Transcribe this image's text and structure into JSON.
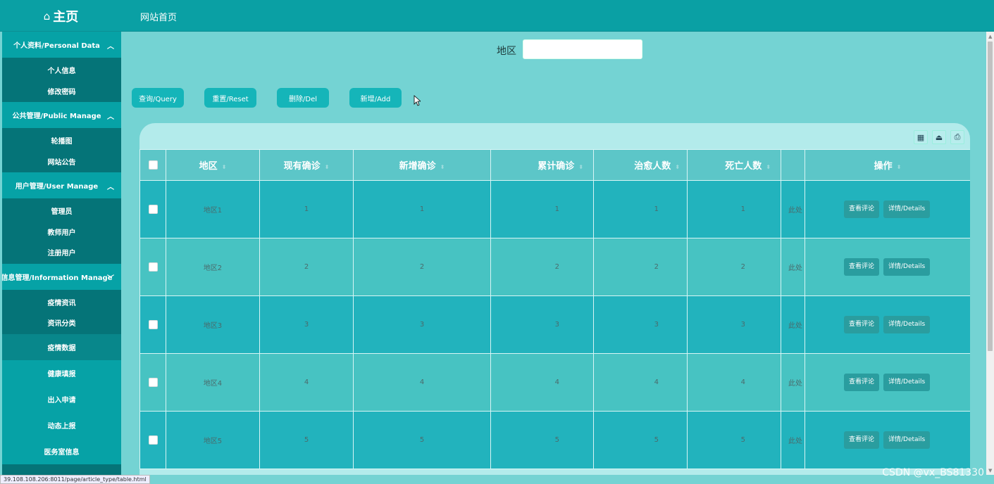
{
  "topbar": {
    "home_icon": "⌂",
    "home_title": "主页",
    "site_home": "网站首页"
  },
  "sidebar": {
    "groups": [
      {
        "title": "个人资料/Personal Data",
        "items": [
          "个人信息",
          "修改密码"
        ]
      },
      {
        "title": "公共管理/Public Manage",
        "items": [
          "轮播图",
          "网站公告"
        ]
      },
      {
        "title": "用户管理/User Manage",
        "items": [
          "管理员",
          "教师用户",
          "注册用户"
        ]
      },
      {
        "title": "信息管理/Information Manage",
        "items": [
          "疫情资讯",
          "资讯分类"
        ]
      }
    ],
    "singles": [
      "疫情数据",
      "健康填报",
      "出入申请",
      "动态上报",
      "医务室信息"
    ]
  },
  "search": {
    "label": "地区",
    "value": ""
  },
  "buttons": {
    "query": "查询/Query",
    "reset": "重置/Reset",
    "delete": "删除/Del",
    "add": "新增/Add"
  },
  "table": {
    "headers": [
      "地区",
      "现有确诊",
      "新增确诊",
      "累计确诊",
      "治愈人数",
      "死亡人数",
      "",
      "操作"
    ],
    "rows": [
      {
        "region": "地区1",
        "current": "1",
        "new": "1",
        "total": "1",
        "cured": "1",
        "deaths": "1",
        "note": "此处"
      },
      {
        "region": "地区2",
        "current": "2",
        "new": "2",
        "total": "2",
        "cured": "2",
        "deaths": "2",
        "note": "此处"
      },
      {
        "region": "地区3",
        "current": "3",
        "new": "3",
        "total": "3",
        "cured": "3",
        "deaths": "3",
        "note": "此处"
      },
      {
        "region": "地区4",
        "current": "4",
        "new": "4",
        "total": "4",
        "cured": "4",
        "deaths": "4",
        "note": "此处"
      },
      {
        "region": "地区5",
        "current": "5",
        "new": "5",
        "total": "5",
        "cured": "5",
        "deaths": "5",
        "note": "此处"
      }
    ],
    "actions": {
      "comments": "查看评论",
      "details": "详情/Details"
    }
  },
  "statusbar": {
    "url": "39.108.108.206:8011/page/article_type/table.html"
  },
  "watermark": "CSDN @vx_BS81330"
}
